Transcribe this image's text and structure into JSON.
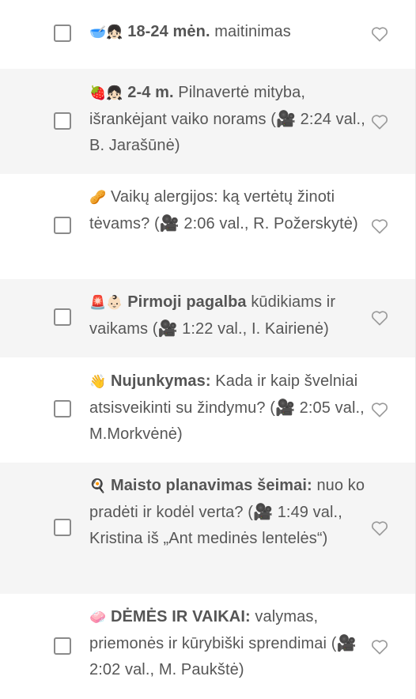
{
  "items": [
    {
      "emoji": "🥣👧🏻",
      "bold": "18-24 mėn.",
      "rest": " maitinimas",
      "heart_icon": "heart-outline-icon",
      "checked": false
    },
    {
      "emoji": "🍓👧🏻",
      "bold": "2-4 m.",
      "rest": " Pilnavertė mityba, išrankėjant vaiko norams (🎥 2:24 val., B. Jarašūnė)",
      "heart_icon": "heart-outline-icon",
      "checked": false
    },
    {
      "emoji": "🥜",
      "bold": "",
      "rest": " Vaikų alergijos: ką vertėtų žinoti tėvams? (🎥 2:06 val., R. Požerskytė)",
      "heart_icon": "heart-outline-icon",
      "checked": false
    },
    {
      "emoji": "🚨👶🏻",
      "bold": "Pirmoji pagalba",
      "rest": " kūdikiams ir vaikams (🎥 1:22 val., I. Kairienė)",
      "heart_icon": "heart-outline-icon",
      "checked": false
    },
    {
      "emoji": "👋",
      "bold": "Nujunkymas:",
      "rest": " Kada ir kaip švelniai atsisveikinti su žindymu? (🎥 2:05 val., M.Morkvėnė)",
      "heart_icon": "heart-outline-icon",
      "checked": false
    },
    {
      "emoji": "🍳",
      "bold": "Maisto planavimas šeimai:",
      "rest": " nuo ko pradėti ir kodėl verta? (🎥 1:49 val., Kristina iš „Ant medinės lentelės“)",
      "heart_icon": "heart-outline-icon",
      "checked": false
    },
    {
      "emoji": "🧼",
      "bold": "DĖMĖS IR VAIKAI:",
      "rest": " valymas, priemonės ir kūrybiški sprendimai (🎥 2:02 val., M. Paukštė)",
      "heart_icon": "heart-outline-icon",
      "checked": false
    }
  ]
}
